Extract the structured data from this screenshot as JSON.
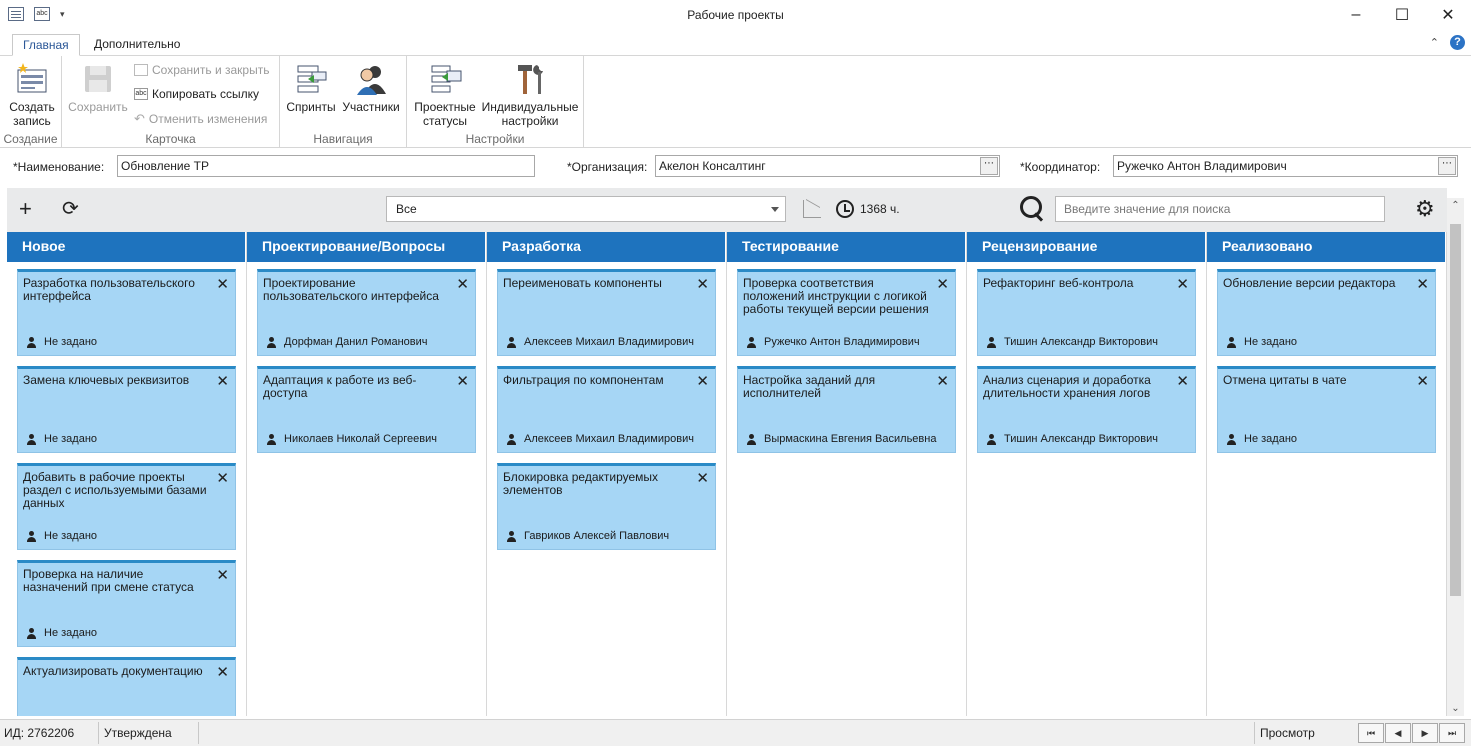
{
  "window": {
    "title": "Рабочие проекты"
  },
  "tabs": [
    {
      "label": "Главная"
    },
    {
      "label": "Дополнительно"
    }
  ],
  "ribbon": {
    "create": {
      "button": "Создать запись",
      "group": "Создание"
    },
    "card": {
      "save": "Сохранить",
      "save_close": "Сохранить и закрыть",
      "copy_link": "Копировать ссылку",
      "undo": "Отменить изменения",
      "group": "Карточка"
    },
    "navigation": {
      "sprints": "Спринты",
      "participants": "Участники",
      "group": "Навигация"
    },
    "settings": {
      "statuses": "Проектные статусы",
      "individual": "Индивидуальные настройки",
      "group": "Настройки"
    }
  },
  "fields": {
    "name_label": "*Наименование:",
    "name_value": "Обновление ТР",
    "org_label": "*Организация:",
    "org_value": "Акелон Консалтинг",
    "coord_label": "*Координатор:",
    "coord_value": "Ружечко Антон Владимирович"
  },
  "toolbar": {
    "filter_value": "Все",
    "hours": "1368 ч.",
    "search_placeholder": "Введите значение для поиска"
  },
  "columns": [
    {
      "title": "Новое",
      "cards": [
        {
          "title": "Разработка пользовательского интерфейса",
          "user": "Не задано"
        },
        {
          "title": "Замена ключевых реквизитов",
          "user": "Не задано"
        },
        {
          "title": "Добавить в рабочие проекты раздел с используемыми базами данных",
          "user": "Не задано"
        },
        {
          "title": "Проверка на наличие назначений при смене статуса",
          "user": "Не задано"
        },
        {
          "title": "Актуализировать документацию",
          "user": ""
        }
      ]
    },
    {
      "title": "Проектирование/Вопросы",
      "cards": [
        {
          "title": "Проектирование пользовательского интерфейса",
          "user": "Дорфман Данил Романович"
        },
        {
          "title": "Адаптация к работе из веб-доступа",
          "user": "Николаев Николай Сергеевич"
        }
      ]
    },
    {
      "title": "Разработка",
      "cards": [
        {
          "title": "Переименовать компоненты",
          "user": "Алексеев Михаил Владимирович"
        },
        {
          "title": "Фильтрация по компонентам",
          "user": "Алексеев Михаил Владимирович"
        },
        {
          "title": "Блокировка редактируемых элементов",
          "user": "Гавриков Алексей Павлович"
        }
      ]
    },
    {
      "title": "Тестирование",
      "cards": [
        {
          "title": "Проверка соответствия положений инструкции с логикой работы текущей версии решения",
          "user": "Ружечко Антон Владимирович"
        },
        {
          "title": "Настройка заданий для исполнителей",
          "user": "Вырмаскина Евгения Васильевна"
        }
      ]
    },
    {
      "title": "Рецензирование",
      "cards": [
        {
          "title": "Рефакторинг веб-контрола",
          "user": "Тишин Александр Викторович"
        },
        {
          "title": "Анализ сценария и доработка длительности хранения логов",
          "user": "Тишин Александр Викторович"
        }
      ]
    },
    {
      "title": "Реализовано",
      "cards": [
        {
          "title": "Обновление версии редактора",
          "user": "Не задано"
        },
        {
          "title": "Отмена цитаты в чате",
          "user": "Не задано"
        }
      ]
    }
  ],
  "statusbar": {
    "id": "ИД: 2762206",
    "state": "Утверждена",
    "mode": "Просмотр"
  }
}
